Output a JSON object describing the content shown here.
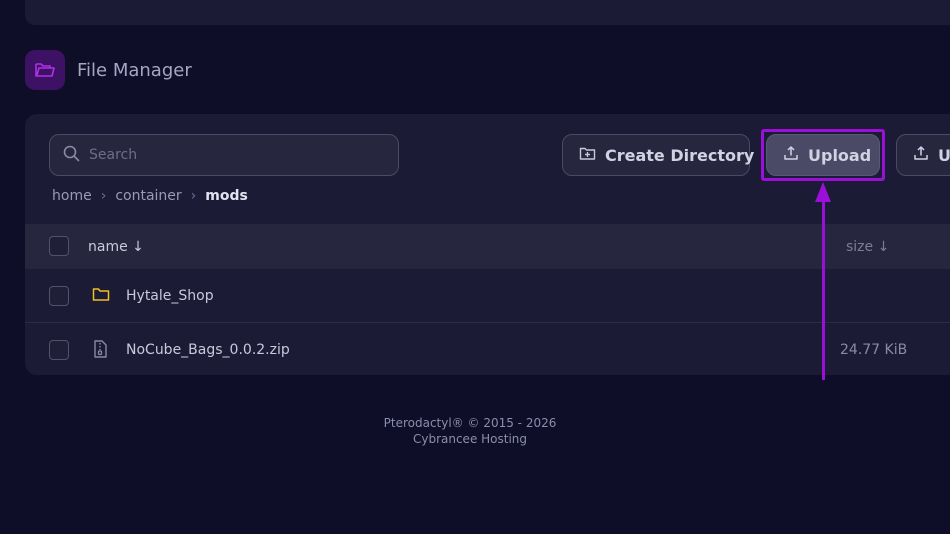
{
  "header": {
    "title": "File Manager",
    "icon": "folder-open-icon"
  },
  "search": {
    "placeholder": "Search",
    "value": ""
  },
  "toolbar": {
    "create_directory_label": "Create Directory",
    "upload_label": "Upload",
    "upload_partial_label": "U"
  },
  "breadcrumb": [
    "home",
    "container",
    "mods"
  ],
  "table": {
    "headers": {
      "name": "name ↓",
      "size": "size ↓"
    },
    "rows": [
      {
        "name": "Hytale_Shop",
        "type": "folder",
        "size": ""
      },
      {
        "name": "NoCube_Bags_0.0.2.zip",
        "type": "archive",
        "size": "24.77 KiB"
      }
    ]
  },
  "footer": {
    "line1": "Pterodactyl® © 2015 - 2026",
    "line2": "Cybrancee Hosting"
  },
  "colors": {
    "background": "#0e0e28",
    "panel": "#1b1b36",
    "accent_highlight": "#9a10d8",
    "folder": "#f0c020"
  }
}
